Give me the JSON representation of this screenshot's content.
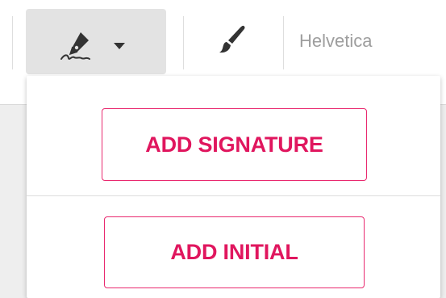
{
  "toolbar": {
    "signature_tool": {
      "icon": "fountain-pen-signature-icon",
      "dropdown_icon": "caret-down-icon"
    },
    "brush_tool": {
      "icon": "paint-brush-icon"
    },
    "font_select": {
      "value": "Helvetica"
    }
  },
  "signature_menu": {
    "add_signature_label": "ADD SIGNATURE",
    "add_initial_label": "ADD INITIAL"
  },
  "colors": {
    "accent": "#e0165e",
    "accent_border": "#e9296f",
    "active_button_bg": "#e3e3e3",
    "icon": "#333333",
    "placeholder_text": "#9e9e9e"
  }
}
